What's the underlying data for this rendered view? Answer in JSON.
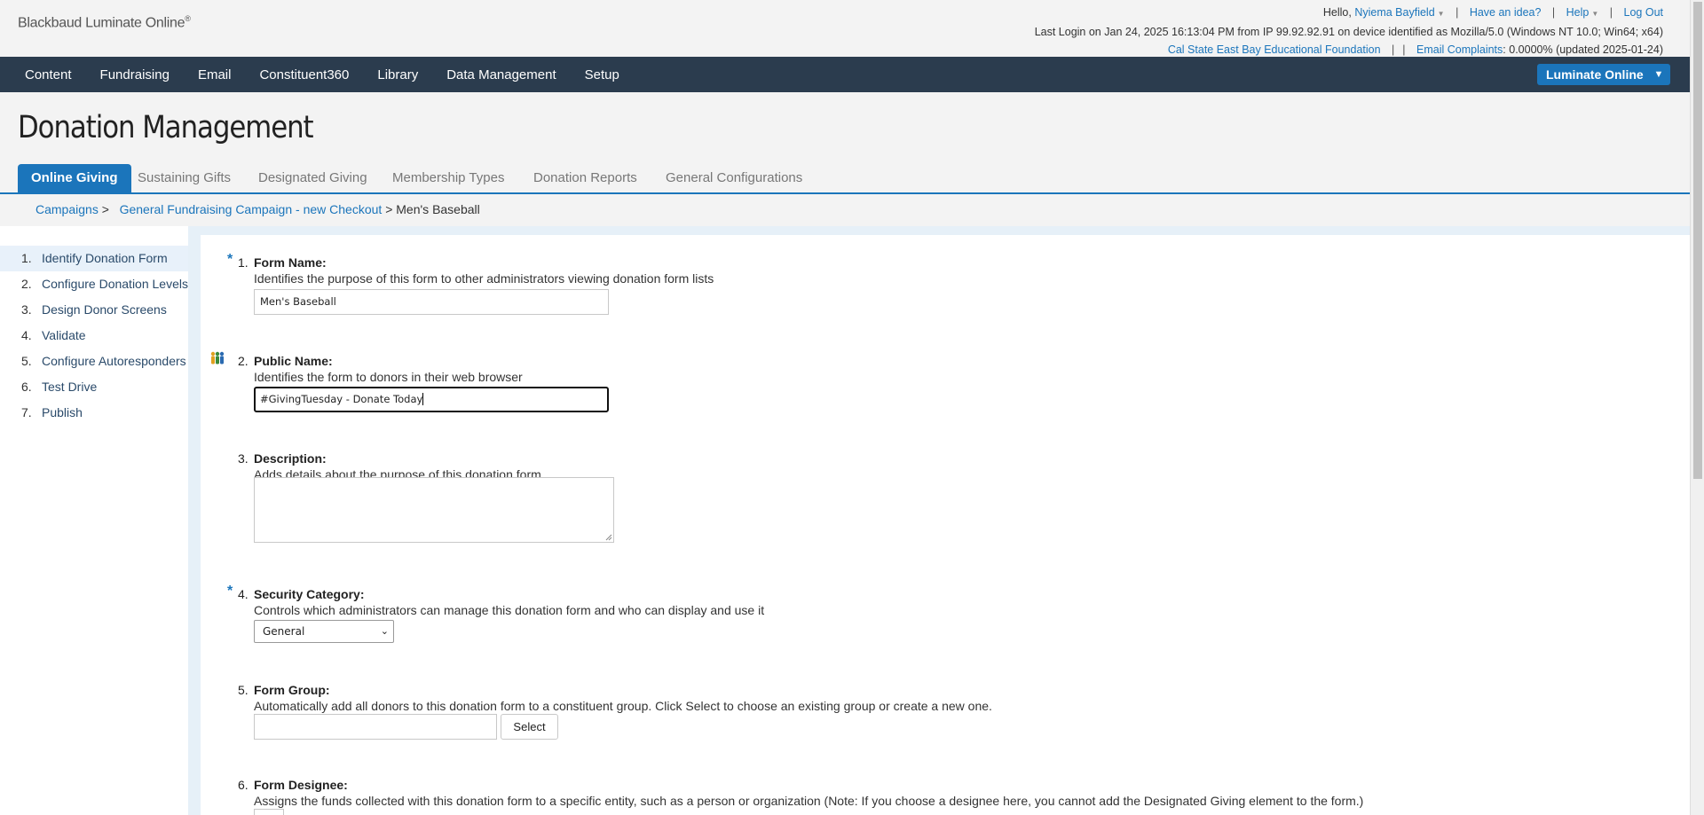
{
  "brand": {
    "name": "Blackbaud Luminate Online",
    "mark": "®"
  },
  "utility": {
    "greeting": "Hello,",
    "user": "Nyiema Bayfield",
    "idea": "Have an idea?",
    "help": "Help",
    "logout": "Log Out",
    "last_login": "Last Login on Jan 24, 2025 16:13:04 PM from IP 99.92.92.91 on device identified as Mozilla/5.0 (Windows NT 10.0; Win64; x64)",
    "org": "Cal State East Bay Educational Foundation",
    "email_label": "Email Complaints",
    "email_value": ": 0.0000% (updated 2025-01-24)"
  },
  "nav": {
    "items": [
      "Content",
      "Fundraising",
      "Email",
      "Constituent360",
      "Library",
      "Data Management",
      "Setup"
    ],
    "product_button": "Luminate Online"
  },
  "page": {
    "title": "Donation Management"
  },
  "tabs": [
    "Online Giving",
    "Sustaining Gifts",
    "Designated Giving",
    "Membership Types",
    "Donation Reports",
    "General Configurations"
  ],
  "breadcrumb": {
    "items": [
      "Campaigns",
      "General Fundraising Campaign - new Checkout"
    ],
    "sep": ">",
    "current": "Men's Baseball"
  },
  "steps": [
    {
      "n": "1.",
      "label": "Identify Donation Form"
    },
    {
      "n": "2.",
      "label": "Configure Donation Levels"
    },
    {
      "n": "3.",
      "label": "Design Donor Screens"
    },
    {
      "n": "4.",
      "label": "Validate"
    },
    {
      "n": "5.",
      "label": "Configure Autoresponders"
    },
    {
      "n": "6.",
      "label": "Test Drive"
    },
    {
      "n": "7.",
      "label": "Publish"
    }
  ],
  "form": {
    "required_mark": "*",
    "f1": {
      "n": "1.",
      "label": "Form Name:",
      "desc": "Identifies the purpose of this form to other administrators viewing donation form lists",
      "value": "Men's Baseball"
    },
    "f2": {
      "n": "2.",
      "label": "Public Name:",
      "desc": "Identifies the form to donors in their web browser",
      "value": "#GivingTuesday - Donate Today"
    },
    "f3": {
      "n": "3.",
      "label": "Description:",
      "desc": "Adds details about the purpose of this donation form"
    },
    "f4": {
      "n": "4.",
      "label": "Security Category:",
      "desc": "Controls which administrators can manage this donation form and who can display and use it",
      "value": "General"
    },
    "f5": {
      "n": "5.",
      "label": "Form Group:",
      "desc": "Automatically add all donors to this donation form to a constituent group. Click Select to choose an existing group or create a new one.",
      "button": "Select"
    },
    "f6": {
      "n": "6.",
      "label": "Form Designee:",
      "desc": "Assigns the funds collected with this donation form to a specific entity, such as a person or organization (Note: If you choose a designee here, you cannot add the Designated Giving element to the form.)"
    }
  }
}
